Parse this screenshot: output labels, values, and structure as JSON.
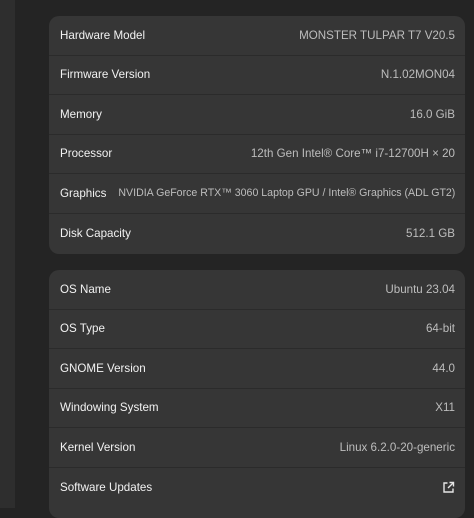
{
  "hardware": {
    "rows": [
      {
        "label": "Hardware Model",
        "value": "MONSTER TULPAR T7 V20.5"
      },
      {
        "label": "Firmware Version",
        "value": "N.1.02MON04"
      },
      {
        "label": "Memory",
        "value": "16.0 GiB"
      },
      {
        "label": "Processor",
        "value": "12th Gen Intel® Core™ i7-12700H × 20"
      },
      {
        "label": "Graphics",
        "value": "NVIDIA GeForce RTX™ 3060 Laptop GPU / Intel® Graphics (ADL GT2)"
      },
      {
        "label": "Disk Capacity",
        "value": "512.1 GB"
      }
    ]
  },
  "software": {
    "rows": [
      {
        "label": "OS Name",
        "value": "Ubuntu 23.04"
      },
      {
        "label": "OS Type",
        "value": "64-bit"
      },
      {
        "label": "GNOME Version",
        "value": "44.0"
      },
      {
        "label": "Windowing System",
        "value": "X11"
      },
      {
        "label": "Kernel Version",
        "value": "Linux 6.2.0-20-generic"
      }
    ],
    "software_updates_label": "Software Updates",
    "software_updates_icon": "external-link-icon"
  }
}
